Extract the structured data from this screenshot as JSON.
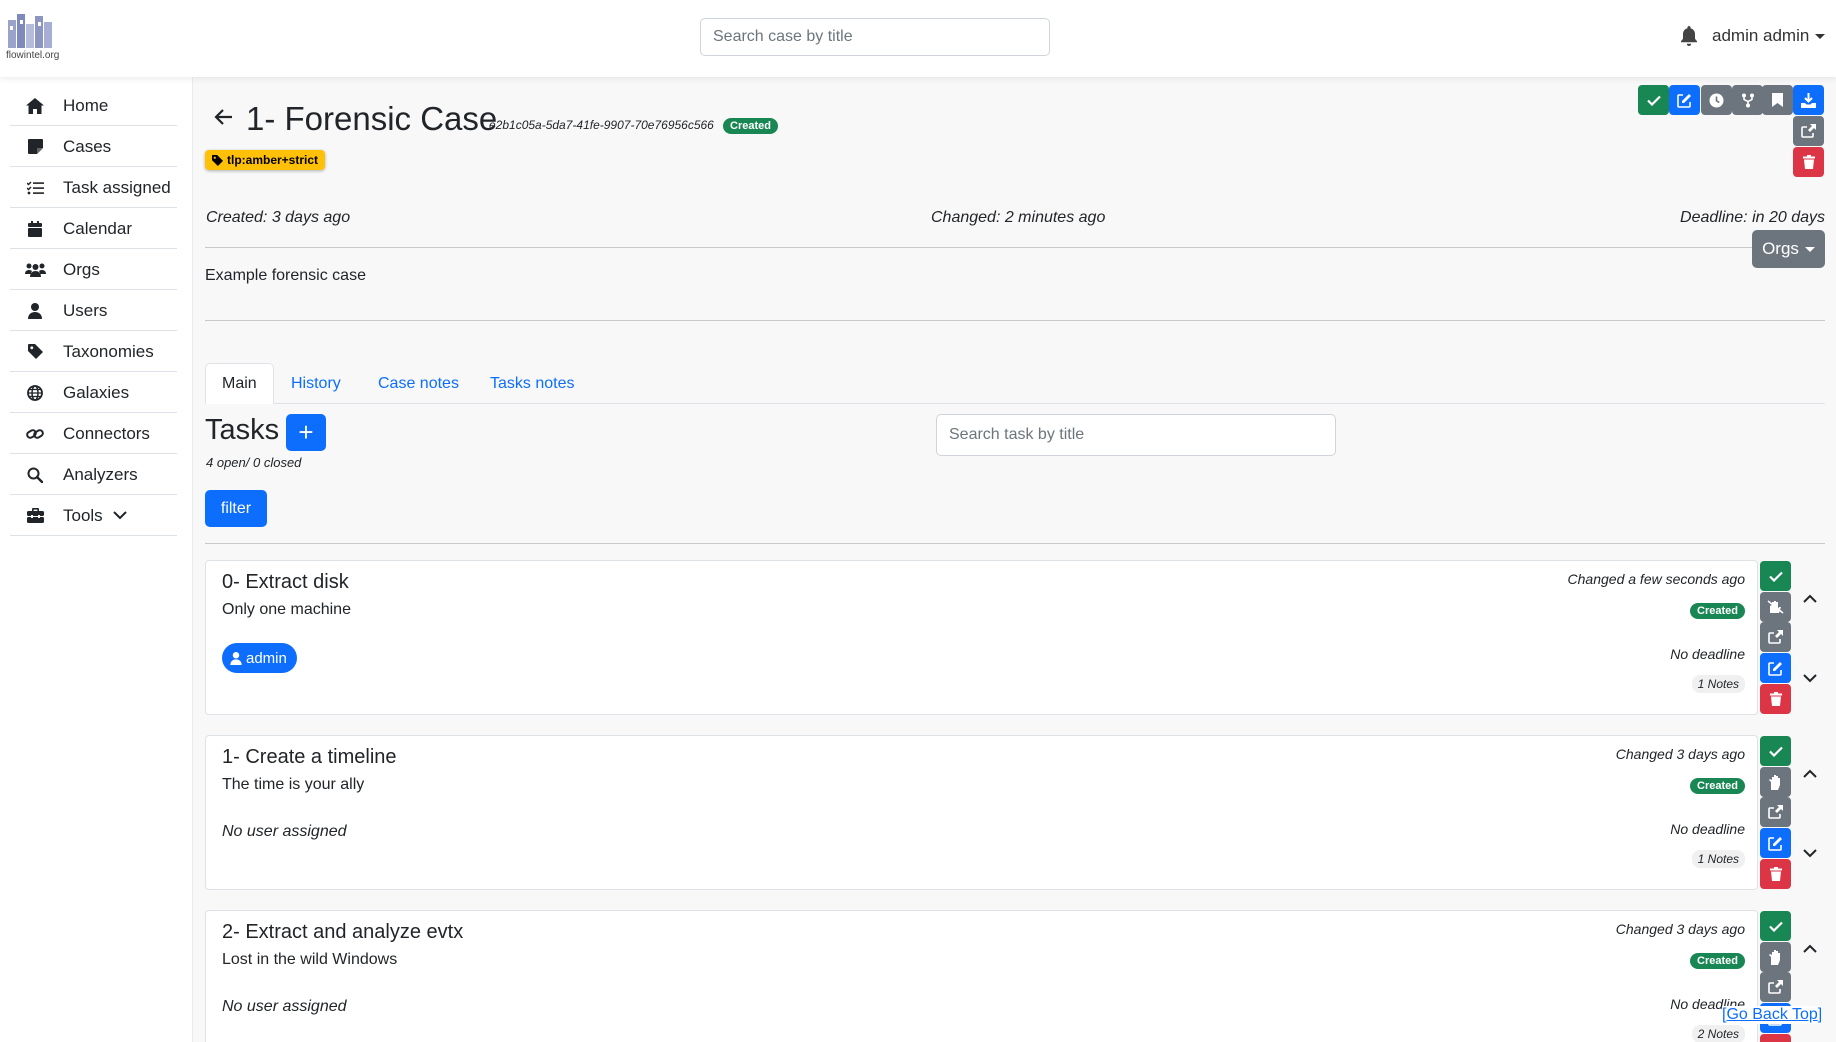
{
  "brand": {
    "logo_text": "flowintel.org"
  },
  "topbar": {
    "search_placeholder": "Search case by title",
    "user": "admin admin"
  },
  "sidebar": {
    "items": [
      {
        "label": "Home",
        "icon": "home-icon"
      },
      {
        "label": "Cases",
        "icon": "note-icon"
      },
      {
        "label": "Task assigned",
        "icon": "task-list-icon"
      },
      {
        "label": "Calendar",
        "icon": "calendar-icon"
      },
      {
        "label": "Orgs",
        "icon": "users-group-icon"
      },
      {
        "label": "Users",
        "icon": "user-icon"
      },
      {
        "label": "Taxonomies",
        "icon": "tag-icon"
      },
      {
        "label": "Galaxies",
        "icon": "globe-icon"
      },
      {
        "label": "Connectors",
        "icon": "link-icon"
      },
      {
        "label": "Analyzers",
        "icon": "search-icon"
      },
      {
        "label": "Tools",
        "icon": "toolbox-icon"
      }
    ]
  },
  "case": {
    "title": "1- Forensic Case",
    "uuid": "e2b1c05a-5da7-41fe-9907-70e76956c566",
    "status": "Created",
    "tag": "tlp:amber+strict",
    "created": "Created: 3 days ago",
    "changed": "Changed: 2 minutes ago",
    "deadline": "Deadline: in 20 days",
    "description": "Example forensic case",
    "orgs_label": "Orgs"
  },
  "tabs": [
    "Main",
    "History",
    "Case notes",
    "Tasks notes"
  ],
  "tasks_section": {
    "title": "Tasks",
    "add_label": "+",
    "count": "4 open/ 0 closed",
    "search_placeholder": "Search task by title",
    "filter_label": "filter"
  },
  "tasks": [
    {
      "title": "0- Extract disk",
      "description": "Only one machine",
      "user": "admin",
      "changed": "Changed a few seconds ago",
      "status": "Created",
      "deadline": "No deadline",
      "notes": "1 Notes"
    },
    {
      "title": "1- Create a timeline",
      "description": "The time is your ally",
      "user": "No user assigned",
      "changed": "Changed 3 days ago",
      "status": "Created",
      "deadline": "No deadline",
      "notes": "1 Notes"
    },
    {
      "title": "2- Extract and analyze evtx",
      "description": "Lost in the wild Windows",
      "user": "No user assigned",
      "changed": "Changed 3 days ago",
      "status": "Created",
      "deadline": "No deadline",
      "notes": "2 Notes"
    }
  ],
  "footer": {
    "go_back_top": "Go Back Top",
    "bracket_open": "[",
    "bracket_close": "]"
  },
  "colors": {
    "primary": "#0d6efd",
    "success": "#198754",
    "secondary": "#6c757d",
    "danger": "#dc3545",
    "warning": "#ffc107"
  }
}
